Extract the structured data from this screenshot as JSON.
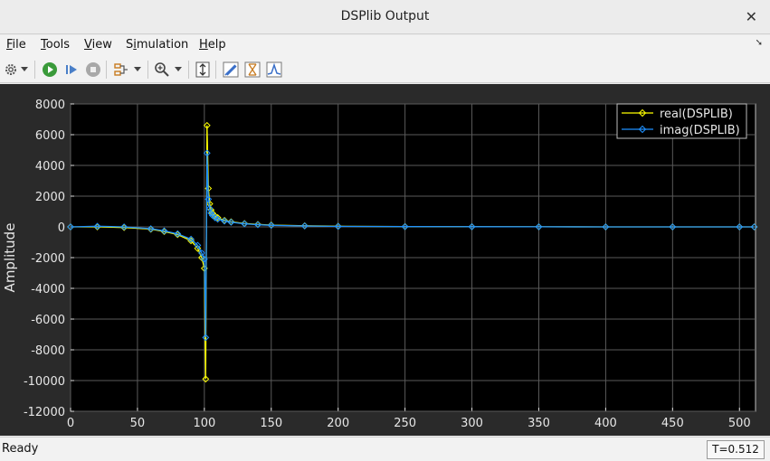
{
  "window": {
    "title": "DSPlib Output"
  },
  "menu": [
    {
      "label": "File",
      "mnemonic_index": 0
    },
    {
      "label": "Tools",
      "mnemonic_index": 0
    },
    {
      "label": "View",
      "mnemonic_index": 0
    },
    {
      "label": "Simulation",
      "mnemonic_index": 1
    },
    {
      "label": "Help",
      "mnemonic_index": 0
    }
  ],
  "toolbar": {
    "icons": [
      "settings-icon",
      "run-icon",
      "step-forward-icon",
      "stop-icon",
      "signal-selector-icon",
      "zoom-in-icon",
      "fit-to-view-icon",
      "cursor-measurement-icon",
      "trigger-icon",
      "peak-finder-icon"
    ]
  },
  "status": {
    "text": "Ready",
    "time": "T=0.512"
  },
  "colors": {
    "real": "#ffff00",
    "imag": "#1e90ff",
    "axes_bg": "#000000",
    "figure_bg": "#2a2a2a",
    "grid": "#5a5a5a",
    "tick_text": "#e6e6e6"
  },
  "chart_data": {
    "type": "line",
    "ylabel": "Amplitude",
    "xlabel": "",
    "xlim": [
      0,
      512
    ],
    "ylim": [
      -12000,
      8000
    ],
    "x_ticks": [
      "0",
      "50",
      "100",
      "150",
      "200",
      "250",
      "300",
      "350",
      "400",
      "450",
      "500"
    ],
    "y_ticks": [
      "8000",
      "6000",
      "4000",
      "2000",
      "0",
      "-2000",
      "-4000",
      "-6000",
      "-8000",
      "-10000",
      "-12000"
    ],
    "grid": true,
    "legend_position": "top-right",
    "series": [
      {
        "name": "real(DSPLIB)",
        "marker": "diamond",
        "x": [
          0,
          20,
          40,
          60,
          70,
          80,
          90,
          95,
          98,
          100,
          101,
          102,
          103,
          104,
          105,
          106,
          108,
          110,
          115,
          120,
          130,
          140,
          150,
          175,
          200,
          250,
          300,
          350,
          400,
          450,
          500,
          511
        ],
        "y": [
          0,
          0,
          -40,
          -150,
          -300,
          -500,
          -900,
          -1400,
          -2000,
          -2700,
          -9900,
          6600,
          2500,
          1500,
          1100,
          900,
          700,
          600,
          420,
          330,
          220,
          160,
          120,
          70,
          40,
          20,
          10,
          5,
          0,
          0,
          0,
          0
        ]
      },
      {
        "name": "imag(DSPLIB)",
        "marker": "diamond",
        "x": [
          0,
          20,
          40,
          60,
          70,
          80,
          90,
          95,
          98,
          100,
          101,
          102,
          103,
          104,
          105,
          106,
          108,
          110,
          115,
          120,
          130,
          140,
          150,
          175,
          200,
          250,
          300,
          350,
          400,
          450,
          500,
          511
        ],
        "y": [
          0,
          40,
          0,
          -120,
          -260,
          -450,
          -800,
          -1200,
          -1700,
          -2100,
          -7200,
          4800,
          1800,
          1200,
          900,
          750,
          600,
          500,
          380,
          300,
          200,
          140,
          100,
          60,
          30,
          15,
          10,
          5,
          0,
          0,
          0,
          0
        ]
      }
    ]
  }
}
